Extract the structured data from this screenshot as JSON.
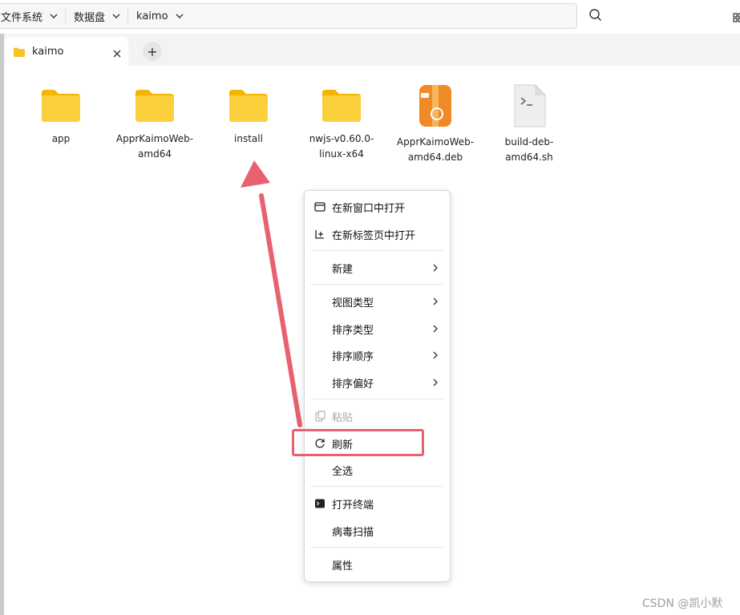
{
  "breadcrumbs": [
    {
      "label": "文件系统"
    },
    {
      "label": "数据盘"
    },
    {
      "label": "kaimo"
    }
  ],
  "tab": {
    "label": "kaimo",
    "add_label": "+"
  },
  "files": [
    {
      "name": "app",
      "type": "folder"
    },
    {
      "name": "ApprKaimoWeb-\namd64",
      "type": "folder"
    },
    {
      "name": "install",
      "type": "folder"
    },
    {
      "name": "nwjs-v0.60.0-\nlinux-x64",
      "type": "folder"
    },
    {
      "name": "ApprKaimoWeb-\namd64.deb",
      "type": "deb-package"
    },
    {
      "name": "build-deb-\namd64.sh",
      "type": "shell-script"
    }
  ],
  "context_menu": {
    "open_new_window": "在新窗口中打开",
    "open_new_tab": "在新标签页中打开",
    "new": "新建",
    "view_type": "视图类型",
    "sort_type": "排序类型",
    "sort_order": "排序顺序",
    "sort_preference": "排序偏好",
    "paste": "粘贴",
    "refresh": "刷新",
    "select_all": "全选",
    "open_terminal": "打开终端",
    "virus_scan": "病毒扫描",
    "properties": "属性"
  },
  "watermark": "CSDN @凯小默",
  "colors": {
    "folder": "#f7c325",
    "highlight": "#e8616e",
    "arrow": "#e8616e"
  }
}
